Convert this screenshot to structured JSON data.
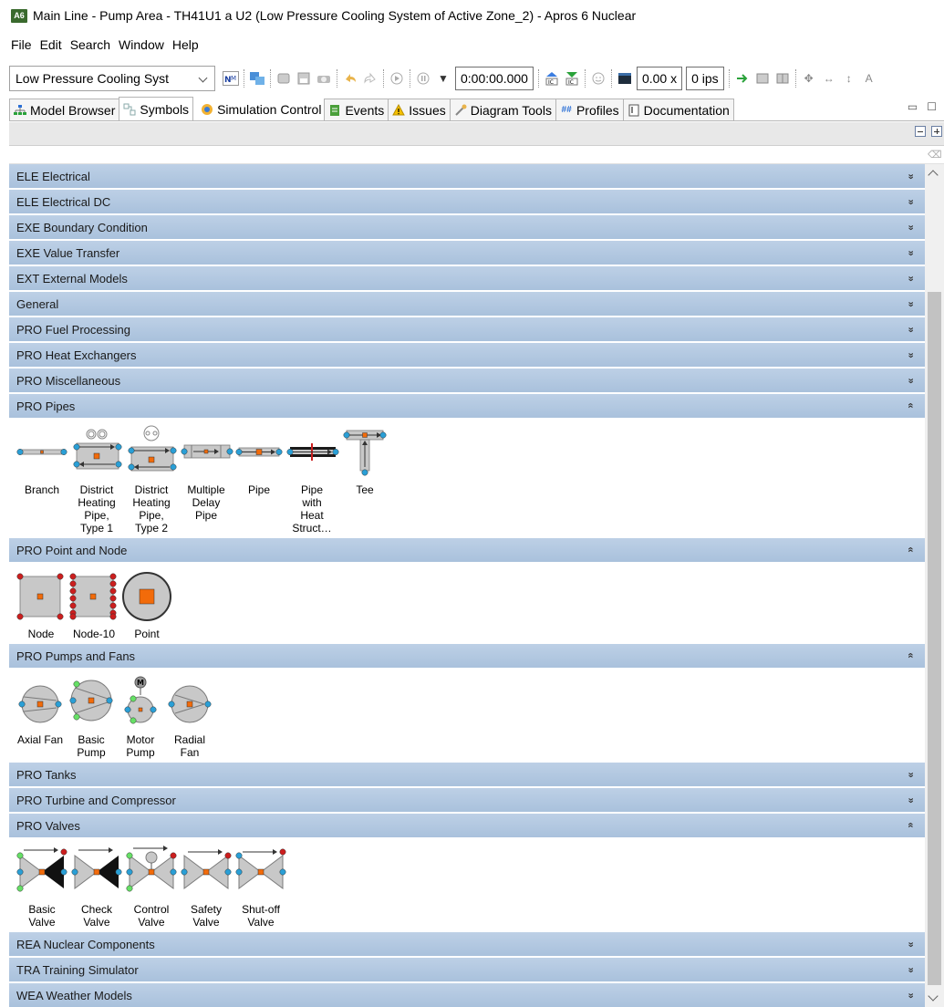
{
  "window": {
    "app_icon_text": "A6",
    "title": "Main Line - Pump Area - TH41U1 a U2 (Low Pressure Cooling System of Active Zone_2) - Apros 6 Nuclear"
  },
  "menu": [
    "File",
    "Edit",
    "Search",
    "Window",
    "Help"
  ],
  "toolbar": {
    "model_combo": "Low Pressure Cooling Syst",
    "time": "0:00:00.000",
    "speed": "0.00 x",
    "ips": "0 ips"
  },
  "tabs": [
    {
      "label": "Model Browser",
      "icon": "model-browser-icon"
    },
    {
      "label": "Symbols",
      "icon": "symbols-icon",
      "active": true
    },
    {
      "label": "Simulation Control",
      "icon": "simulation-control-icon"
    },
    {
      "label": "Events",
      "icon": "events-icon"
    },
    {
      "label": "Issues",
      "icon": "warning-icon"
    },
    {
      "label": "Diagram Tools",
      "icon": "diagram-tools-icon"
    },
    {
      "label": "Profiles",
      "icon": "profiles-icon"
    },
    {
      "label": "Documentation",
      "icon": "documentation-icon"
    }
  ],
  "categories": [
    {
      "label": "ELE Electrical",
      "expanded": false
    },
    {
      "label": "ELE Electrical DC",
      "expanded": false
    },
    {
      "label": "EXE Boundary Condition",
      "expanded": false
    },
    {
      "label": "EXE Value Transfer",
      "expanded": false
    },
    {
      "label": "EXT External Models",
      "expanded": false
    },
    {
      "label": "General",
      "expanded": false
    },
    {
      "label": "PRO Fuel Processing",
      "expanded": false
    },
    {
      "label": "PRO Heat Exchangers",
      "expanded": false
    },
    {
      "label": "PRO Miscellaneous",
      "expanded": false
    },
    {
      "label": "PRO Pipes",
      "expanded": true,
      "items": [
        "Branch",
        "District\nHeating\nPipe,\nType 1",
        "District\nHeating\nPipe,\nType 2",
        "Multiple\nDelay\nPipe",
        "Pipe",
        "Pipe\nwith\nHeat\nStruct…",
        "Tee"
      ]
    },
    {
      "label": "PRO Point and Node",
      "expanded": true,
      "items": [
        "Node",
        "Node-10",
        "Point"
      ]
    },
    {
      "label": "PRO Pumps and Fans",
      "expanded": true,
      "items": [
        "Axial Fan",
        "Basic\nPump",
        "Motor\nPump",
        "Radial\nFan"
      ]
    },
    {
      "label": "PRO Tanks",
      "expanded": false
    },
    {
      "label": "PRO Turbine and Compressor",
      "expanded": false
    },
    {
      "label": "PRO Valves",
      "expanded": true,
      "items": [
        "Basic\nValve",
        "Check\nValve",
        "Control\nValve",
        "Safety\nValve",
        "Shut-off\nValve"
      ]
    },
    {
      "label": "REA Nuclear Components",
      "expanded": false
    },
    {
      "label": "TRA Training Simulator",
      "expanded": false
    },
    {
      "label": "WEA Weather Models",
      "expanded": false
    }
  ],
  "colors": {
    "category_bg": "#b3c8e1",
    "port_blue": "#2a9fd6",
    "port_green": "#66e066",
    "port_red": "#cc1e1e",
    "node_orange": "#f26b0a"
  }
}
